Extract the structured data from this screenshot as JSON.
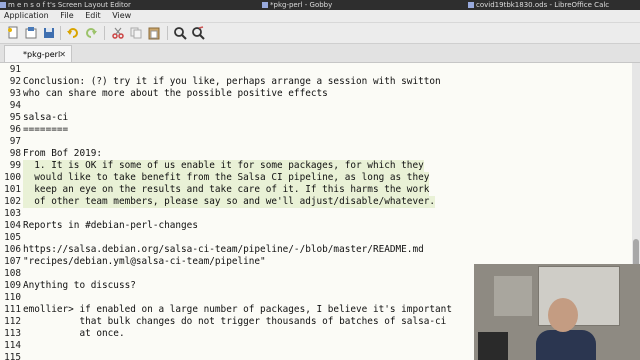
{
  "taskbar": [
    {
      "label": "m e n s o f t's Screen Layout Editor"
    },
    {
      "label": "*pkg-perl - Gobby"
    },
    {
      "label": "covid19tbk1830.ods - LibreOffice Calc"
    }
  ],
  "menu": [
    "Application",
    "File",
    "Edit",
    "View"
  ],
  "toolbar_icons": [
    "new-document-icon",
    "open-icon",
    "save-icon",
    "undo-icon",
    "redo-icon",
    "cut-icon",
    "copy-icon",
    "paste-icon",
    "find-icon",
    "find-replace-icon"
  ],
  "tab": {
    "title": "*pkg-perl",
    "close": "✕"
  },
  "lines": [
    {
      "n": "91",
      "text": "",
      "hl": false
    },
    {
      "n": "92",
      "text": "Conclusion: (?) try it if you like, perhaps arrange a session with switton",
      "hl": false
    },
    {
      "n": "93",
      "text": "who can share more about the possible positive effects",
      "hl": false
    },
    {
      "n": "94",
      "text": "",
      "hl": false
    },
    {
      "n": "95",
      "text": "salsa-ci",
      "hl": false
    },
    {
      "n": "96",
      "text": "========",
      "hl": false
    },
    {
      "n": "97",
      "text": "",
      "hl": false
    },
    {
      "n": "98",
      "text": "From Bof 2019:",
      "hl": false
    },
    {
      "n": "99",
      "text": "  1. It is OK if some of us enable it for some packages, for which they",
      "hl": true
    },
    {
      "n": "100",
      "text": "  would like to take benefit from the Salsa CI pipeline, as long as they",
      "hl": true
    },
    {
      "n": "101",
      "text": "  keep an eye on the results and take care of it. If this harms the work",
      "hl": true
    },
    {
      "n": "102",
      "text": "  of other team members, please say so and we'll adjust/disable/whatever.",
      "hl": true
    },
    {
      "n": "103",
      "text": "",
      "hl": false
    },
    {
      "n": "104",
      "text": "Reports in #debian-perl-changes",
      "hl": false
    },
    {
      "n": "105",
      "text": "",
      "hl": false
    },
    {
      "n": "106",
      "text": "https://salsa.debian.org/salsa-ci-team/pipeline/-/blob/master/README.md",
      "hl": false
    },
    {
      "n": "107",
      "text": "\"recipes/debian.yml@salsa-ci-team/pipeline\"",
      "hl": false
    },
    {
      "n": "108",
      "text": "",
      "hl": false
    },
    {
      "n": "109",
      "text": "Anything to discuss?",
      "hl": false
    },
    {
      "n": "110",
      "text": "",
      "hl": false
    },
    {
      "n": "111",
      "text": "emollier> if enabled on a large number of packages, I believe it's important",
      "hl": false
    },
    {
      "n": "112",
      "text": "          that bulk changes do not trigger thousands of batches of salsa-ci",
      "hl": false
    },
    {
      "n": "113",
      "text": "          at once.",
      "hl": false
    },
    {
      "n": "114",
      "text": "",
      "hl": false
    },
    {
      "n": "115",
      "text": "",
      "hl": false
    }
  ]
}
